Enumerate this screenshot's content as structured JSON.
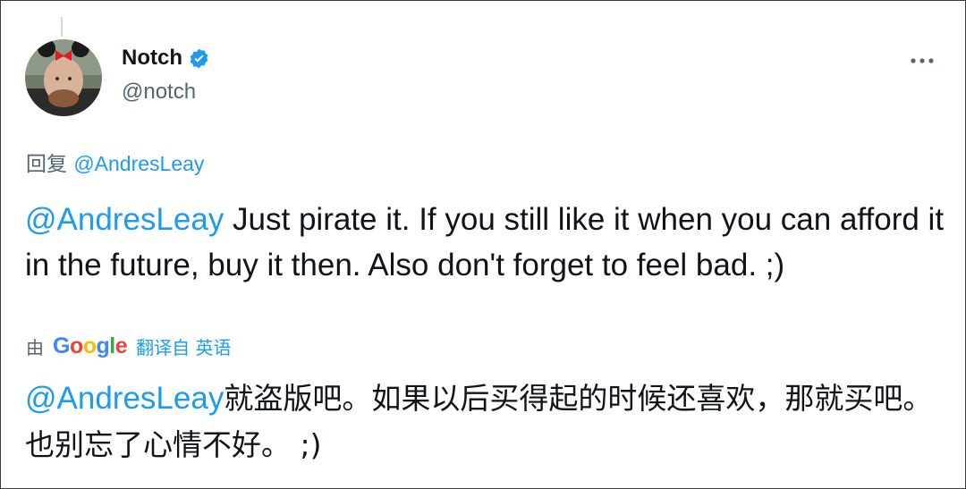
{
  "author": {
    "name": "Notch",
    "handle": "@notch",
    "verified": true,
    "avatar_icon": "avatar-photo"
  },
  "more_icon": "more-dots-icon",
  "replying_to": {
    "prefix": "回复",
    "mention": "@AndresLeay"
  },
  "tweet": {
    "mention": "@AndresLeay",
    "text": " Just pirate it. If you still like it when you can afford it in the future, buy it then. Also don't forget to feel bad. ;)"
  },
  "translation": {
    "by_label": "由",
    "provider": "Google",
    "from_label": "翻译自 英语",
    "mention": "@AndresLeay",
    "text": "就盗版吧。如果以后买得起的时候还喜欢，那就买吧。也别忘了心情不好。 ;)"
  },
  "colors": {
    "link": "#1d9bf0",
    "secondary": "#536471",
    "primary": "#0f1419",
    "verified_badge": "#1d9bf0"
  }
}
